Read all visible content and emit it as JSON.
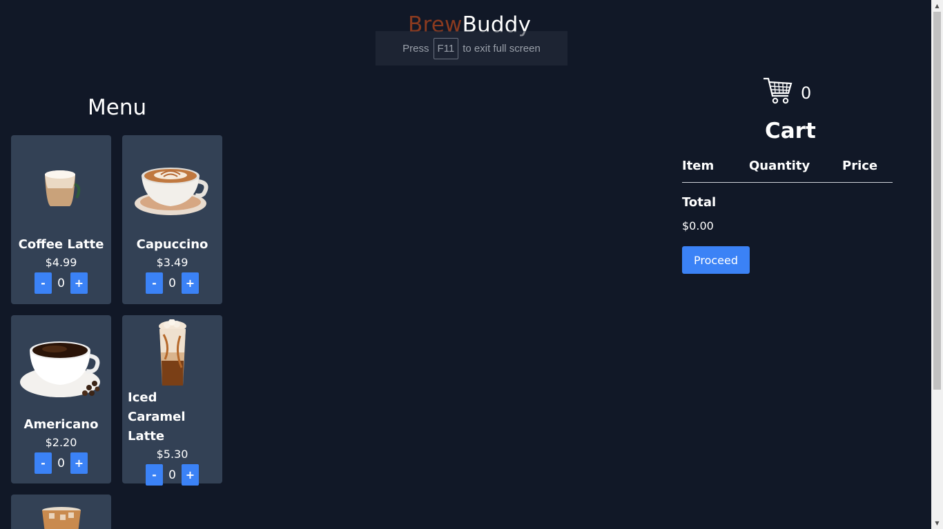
{
  "brand": {
    "part1": "Brew",
    "part2": "Buddy"
  },
  "fullscreen_notice": {
    "before": "Press",
    "key": "F11",
    "after": "to exit full screen"
  },
  "menu": {
    "title": "Menu",
    "items": [
      {
        "name": "Coffee Latte",
        "price": "$4.99",
        "qty": "0",
        "minus": "-",
        "plus": "+"
      },
      {
        "name": "Capuccino",
        "price": "$3.49",
        "qty": "0",
        "minus": "-",
        "plus": "+"
      },
      {
        "name": "Americano",
        "price": "$2.20",
        "qty": "0",
        "minus": "-",
        "plus": "+"
      },
      {
        "name": "Iced Caramel Latte",
        "price": "$5.30",
        "qty": "0",
        "minus": "-",
        "plus": "+"
      }
    ]
  },
  "cart": {
    "icon": "shopping-cart-icon",
    "count": "0",
    "title": "Cart",
    "columns": [
      "Item",
      "Quantity",
      "Price"
    ],
    "total_label": "Total",
    "total_value": "$0.00",
    "proceed_label": "Proceed"
  },
  "colors": {
    "background": "#111827",
    "card": "#334155",
    "accent": "#3b82f6",
    "brand_first": "#8a3a1f"
  }
}
